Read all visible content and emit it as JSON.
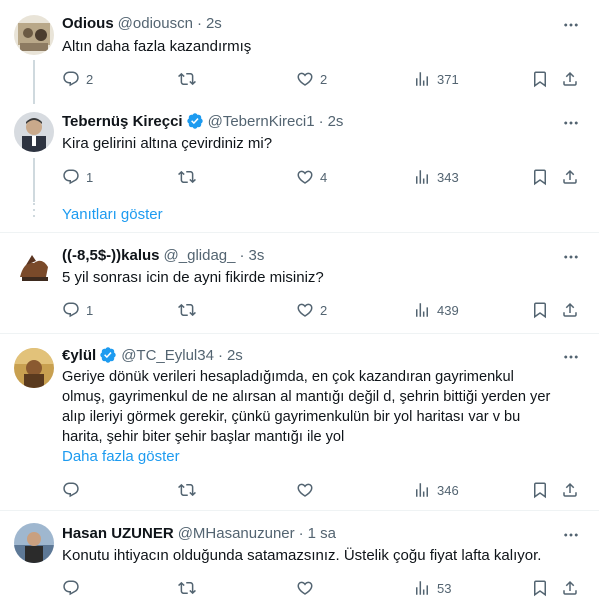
{
  "colors": {
    "accent": "#1d9bf0",
    "muted": "#536471",
    "text": "#0f1419",
    "line": "#cfd9de"
  },
  "icons": {
    "reply": "reply-icon",
    "retweet": "retweet-icon",
    "like": "heart-icon",
    "views": "views-icon",
    "bookmark": "bookmark-icon",
    "share": "share-icon",
    "more": "more-icon",
    "verified": "verified-badge-icon"
  },
  "tweets": [
    {
      "name": "Odious",
      "handle": "@odiouscn",
      "time": "2s",
      "lines": [
        "Altın daha fazla kazandırmış"
      ],
      "replies": "2",
      "retweets": "",
      "likes": "2",
      "views": "371"
    },
    {
      "name": "Tebernüş Kireçci",
      "handle": "@TebernKireci1",
      "time": "2s",
      "lines": [
        "Kira gelirini altına çevirdiniz mi?"
      ],
      "replies": "1",
      "retweets": "",
      "likes": "4",
      "views": "343"
    },
    {
      "name": "((-8,5$-))kalus",
      "handle": "@_glidag_",
      "time": "3s",
      "lines": [
        "5 yil sonrası icin de ayni fikirde misiniz?"
      ],
      "replies": "1",
      "retweets": "",
      "likes": "2",
      "views": "439"
    },
    {
      "name": "€ylül",
      "handle": "@TC_Eylul34",
      "time": "2s",
      "lines": [
        "Geriye dönük verileri hesapladığımda, en çok kazandıran gayrimenkul",
        "olmuş, gayrimenkul de ne alırsan al mantığı değil d,  şehrin bittiği yerden yer",
        "alıp ileriyi görmek gerekir, çünkü gayrimenkulün bir yol haritası var v bu",
        "harita,  şehir biter şehir başlar mantığı ile yol"
      ],
      "more_label": "Daha fazla göster",
      "replies": "",
      "retweets": "",
      "likes": "",
      "views": "346"
    },
    {
      "name": "Hasan UZUNER",
      "handle": "@MHasanuzuner",
      "time": "1 sa",
      "lines": [
        "Konutu ihtiyacın olduğunda satamazsınız. Üstelik çoğu fiyat lafta kalıyor."
      ],
      "replies": "",
      "retweets": "",
      "likes": "",
      "views": "53"
    }
  ],
  "thread": {
    "show_replies": "Yanıtları göster"
  },
  "separator": "·"
}
